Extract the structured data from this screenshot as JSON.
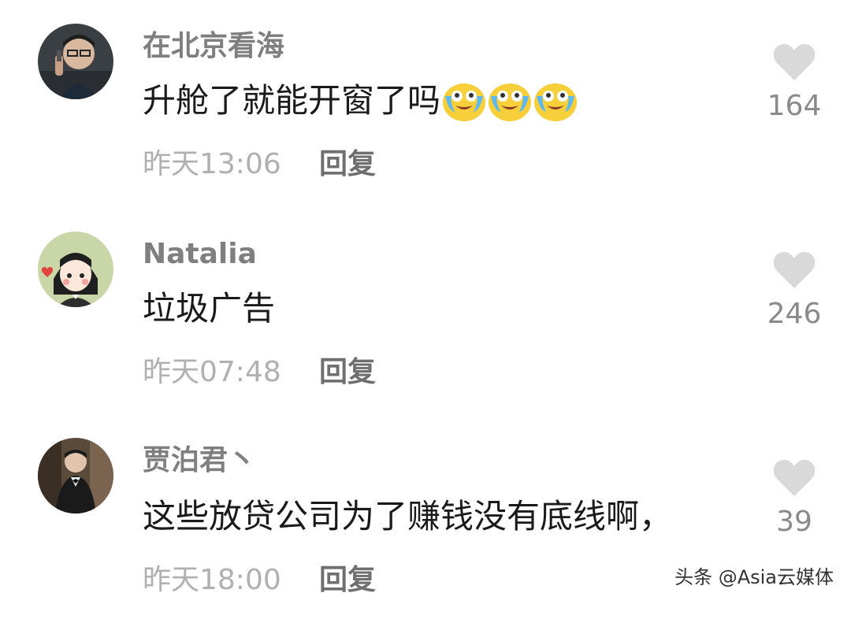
{
  "comments": [
    {
      "username": "在北京看海",
      "text": "升舱了就能开窗了吗",
      "emoji": [
        "tear-laugh-emoji",
        "tear-laugh-emoji",
        "tear-laugh-emoji"
      ],
      "time": "昨天13:06",
      "reply_label": "回复",
      "likes": "164",
      "avatar": "photo-man-on-phone"
    },
    {
      "username": "Natalia",
      "text": "垃圾广告",
      "emoji": [],
      "time": "昨天07:48",
      "reply_label": "回复",
      "likes": "246",
      "avatar": "cartoon-girl"
    },
    {
      "username": "贾泊君丶",
      "text": "这些放贷公司为了赚钱没有底线啊，",
      "emoji": [],
      "time": "昨天18:00",
      "reply_label": "回复",
      "likes": "39",
      "avatar": "photo-man-in-suit"
    }
  ],
  "watermark": "头条 @Asia云媒体",
  "colors": {
    "username": "#7f7f7f",
    "text": "#1a1a1a",
    "meta": "#b0b0b0",
    "heart": "#d9d9d9"
  },
  "icons": {
    "like": "heart-icon",
    "emoji": "tear-laugh-emoji"
  }
}
